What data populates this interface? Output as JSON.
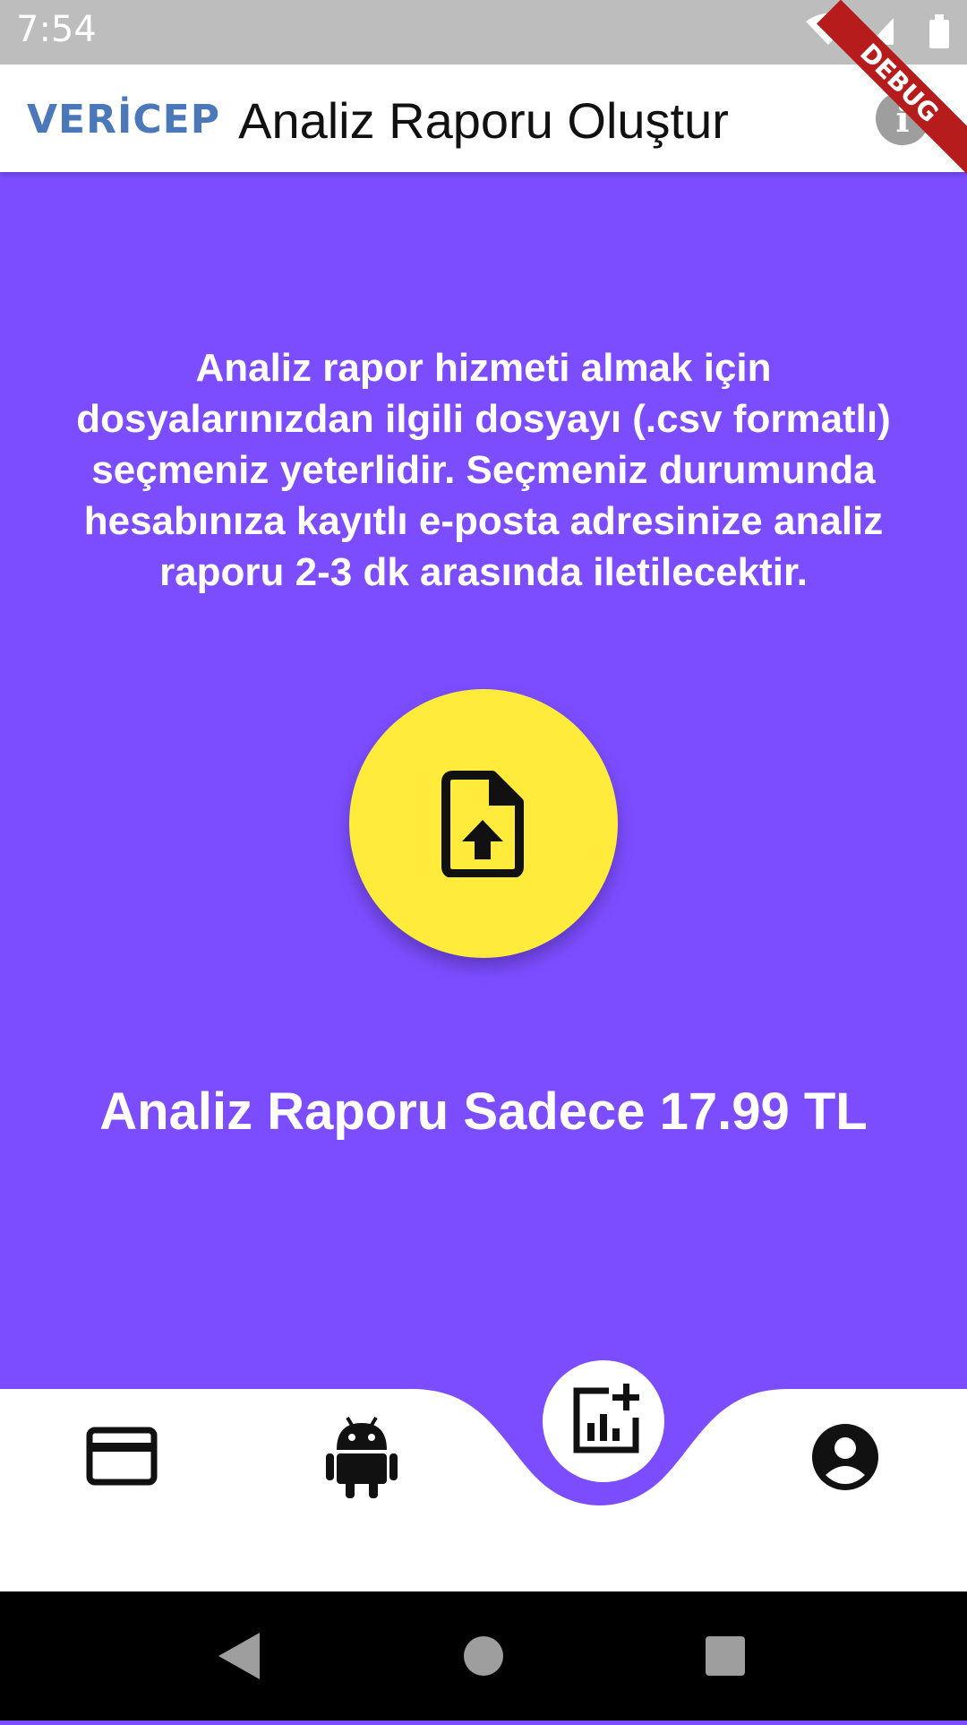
{
  "status_bar": {
    "time": "7:54",
    "icons": [
      "wifi-icon",
      "signal-icon",
      "battery-icon"
    ]
  },
  "debug_banner": {
    "label": "DEBUG",
    "color": "#b71c1c"
  },
  "app_bar": {
    "logo_text": "VERİCEP",
    "title": "Analiz Raporu Oluştur",
    "info_label": "i"
  },
  "main": {
    "background": "#7c4dff",
    "description_lines": [
      "Analiz rapor hizmeti almak için",
      "dosyalarınızdan ilgili dosyayı (.csv formatlı)",
      "seçmeniz yeterlidir. Seçmeniz durumunda",
      "hesabınıza kayıtlı e-posta adresinize analiz",
      "raporu 2-3 dk arasında iletilecektir."
    ],
    "upload_icon": "file-upload-icon",
    "upload_color": "#ffeb3b",
    "price_text": "Analiz Raporu Sadece 17.99 TL"
  },
  "bottom_nav": {
    "items": [
      {
        "icon": "credit-card-icon"
      },
      {
        "icon": "android-icon"
      },
      {
        "icon": "add-chart-icon",
        "active": true
      },
      {
        "icon": "account-circle-icon"
      }
    ]
  },
  "system_nav": {
    "icons": [
      "back-icon",
      "home-icon",
      "recents-icon"
    ]
  }
}
